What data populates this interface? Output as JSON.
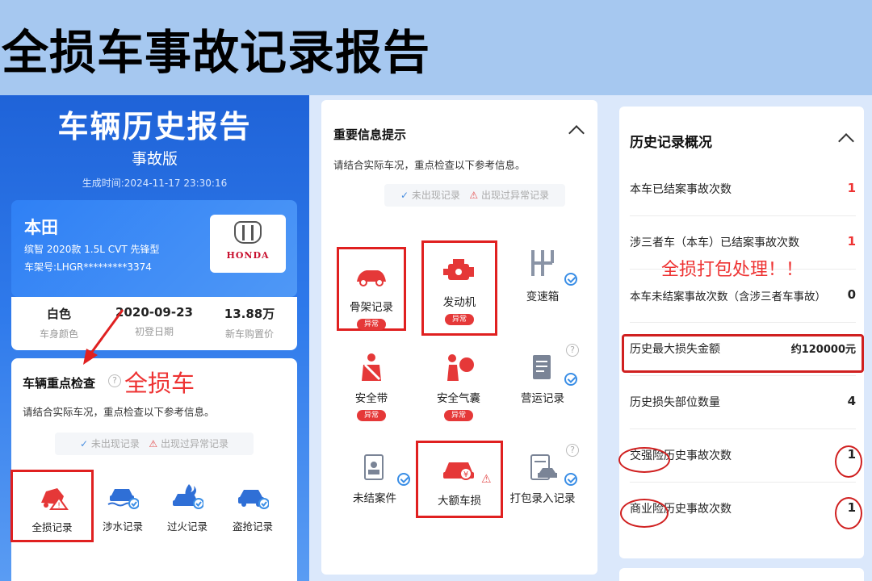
{
  "headline": "全损车事故记录报告",
  "report": {
    "title": "车辆历史报告",
    "subtitle": "事故版",
    "generated_label": "生成时间:",
    "generated_at": "2024-11-17 23:30:16"
  },
  "vehicle": {
    "brand": "本田",
    "model": "缤智 2020款 1.5L CVT 先锋型",
    "vin_label": "车架号:",
    "vin": "LHGR*********3374",
    "logo_text": "HONDA",
    "stats": [
      {
        "value": "白色",
        "label": "车身颜色"
      },
      {
        "value": "2020-09-23",
        "label": "初登日期"
      },
      {
        "value": "13.88万",
        "label": "新车购置价"
      }
    ]
  },
  "key_check": {
    "title": "车辆重点检查",
    "annotation": "全损车",
    "description": "请结合实际车况，重点检查以下参考信息。",
    "legend": {
      "ok": "未出现记录",
      "warn": "出现过异常记录"
    },
    "items": [
      {
        "label": "全损记录",
        "icon": "total-loss-icon",
        "status": "warn"
      },
      {
        "label": "涉水记录",
        "icon": "flood-car-icon",
        "status": "ok"
      },
      {
        "label": "过火记录",
        "icon": "fire-car-icon",
        "status": "ok"
      },
      {
        "label": "盗抢记录",
        "icon": "theft-car-icon",
        "status": "ok"
      }
    ]
  },
  "important": {
    "title": "重要信息提示",
    "description": "请结合实际车况，重点检查以下参考信息。",
    "legend": {
      "ok": "未出现记录",
      "warn": "出现过异常记录"
    },
    "badge_text": "异常",
    "tiles": [
      {
        "label": "骨架记录",
        "icon": "car-frame-icon",
        "status": "warn"
      },
      {
        "label": "发动机",
        "icon": "engine-icon",
        "status": "warn"
      },
      {
        "label": "变速箱",
        "icon": "gearbox-icon",
        "status": "ok"
      },
      {
        "label": "安全带",
        "icon": "seatbelt-icon",
        "status": "warn"
      },
      {
        "label": "安全气囊",
        "icon": "airbag-icon",
        "status": "warn"
      },
      {
        "label": "营运记录",
        "icon": "clipboard-icon",
        "status": "ok"
      },
      {
        "label": "未结案件",
        "icon": "pending-case-icon",
        "status": "ok"
      },
      {
        "label": "大额车损",
        "icon": "car-damage-icon",
        "status": "warn"
      },
      {
        "label": "打包录入记录",
        "icon": "package-record-icon",
        "status": "ok"
      }
    ]
  },
  "history": {
    "title": "历史记录概况",
    "annotation": "全损打包处理！！",
    "rows": [
      {
        "label": "本车已结案事故次数",
        "value": "1"
      },
      {
        "label": "涉三者车（本车）已结案事故次数",
        "value": "1"
      },
      {
        "label": "本车未结案事故次数（含涉三者车事故）",
        "value": "0"
      },
      {
        "label": "历史最大损失金额",
        "value": "约120000元"
      },
      {
        "label": "历史损失部位数量",
        "value": "4"
      },
      {
        "label": "交强险历史事故次数",
        "value": "1"
      },
      {
        "label": "商业险历史事故次数",
        "value": "1"
      }
    ]
  },
  "colors": {
    "brand_blue": "#2f7aeb",
    "alert_red": "#e53838",
    "ok_blue": "#3a8ee6",
    "background": "#a6c8f0"
  }
}
